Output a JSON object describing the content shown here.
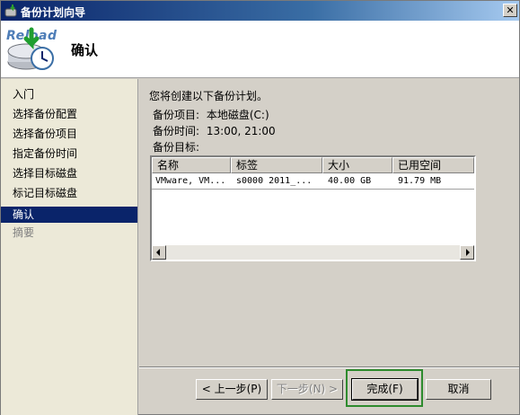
{
  "window": {
    "title": "备份计划向导",
    "watermark": "Reload"
  },
  "header": {
    "title": "确认",
    "icon": "backup-schedule-icon"
  },
  "sidebar": {
    "items": [
      {
        "label": "入门",
        "state": "normal"
      },
      {
        "label": "选择备份配置",
        "state": "normal"
      },
      {
        "label": "选择备份项目",
        "state": "normal"
      },
      {
        "label": "指定备份时间",
        "state": "normal"
      },
      {
        "label": "选择目标磁盘",
        "state": "normal"
      },
      {
        "label": "标记目标磁盘",
        "state": "normal"
      },
      {
        "label": "确认",
        "state": "active"
      },
      {
        "label": "摘要",
        "state": "disabled"
      }
    ]
  },
  "main": {
    "intro": "您将创建以下备份计划。",
    "items_label": "备份项目:",
    "items_value": "本地磁盘(C:)",
    "time_label": "备份时间:",
    "time_value": "13:00, 21:00",
    "target_label": "备份目标:"
  },
  "table": {
    "columns": [
      "名称",
      "标签",
      "大小",
      "已用空间"
    ],
    "rows": [
      {
        "name": "VMware, VM...",
        "tag": "s0000 2011_...",
        "size": "40.00 GB",
        "used": "91.79 MB"
      }
    ]
  },
  "buttons": {
    "back": "< 上一步(P)",
    "next": "下一步(N) >",
    "finish": "完成(F)",
    "cancel": "取消"
  },
  "colors": {
    "selection": "#0a246a",
    "focus_highlight": "#2e8b2e"
  }
}
